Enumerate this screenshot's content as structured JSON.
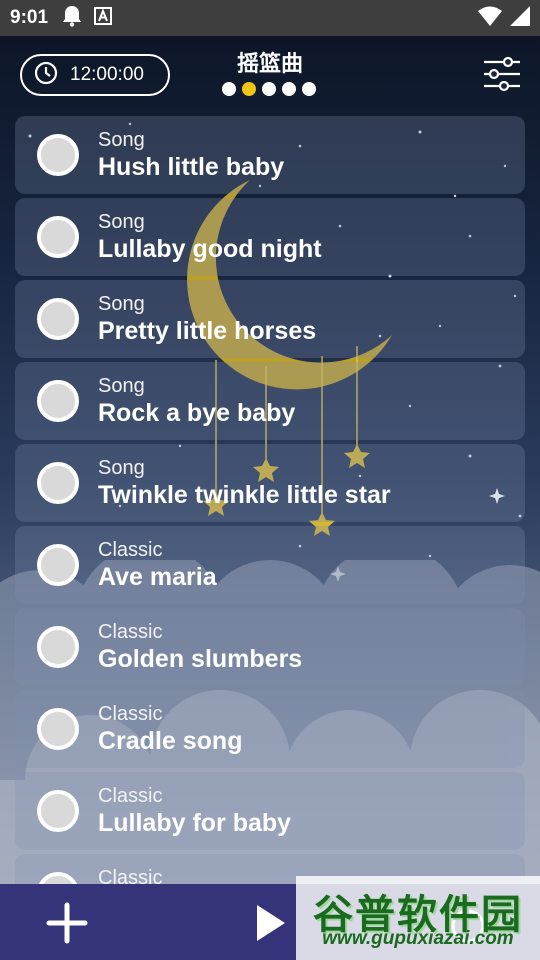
{
  "status_bar": {
    "time": "9:01",
    "icons": [
      "notification-bell-icon",
      "text-icon",
      "wifi-icon",
      "signal-icon"
    ]
  },
  "header": {
    "timer_label": "12:00:00",
    "title": "摇篮曲",
    "dots": {
      "count": 5,
      "active_index": 1
    }
  },
  "songs": [
    {
      "category": "Song",
      "title": "Hush little baby"
    },
    {
      "category": "Song",
      "title": "Lullaby good night"
    },
    {
      "category": "Song",
      "title": "Pretty little horses"
    },
    {
      "category": "Song",
      "title": "Rock a bye baby"
    },
    {
      "category": "Song",
      "title": "Twinkle twinkle little star"
    },
    {
      "category": "Classic",
      "title": "Ave maria"
    },
    {
      "category": "Classic",
      "title": "Golden slumbers"
    },
    {
      "category": "Classic",
      "title": "Cradle song"
    },
    {
      "category": "Classic",
      "title": "Lullaby for baby"
    },
    {
      "category": "Classic",
      "title": ""
    }
  ],
  "bottom_bar": {
    "icons": [
      "add-icon",
      "play-icon",
      "timer-icon"
    ]
  },
  "watermark": {
    "brand": "谷普软件园",
    "url": "www.gupuxiazai.com"
  },
  "colors": {
    "accent_dot": "#f0c419",
    "bottom_bar": "#35347a",
    "moon": "#c9a92a"
  }
}
